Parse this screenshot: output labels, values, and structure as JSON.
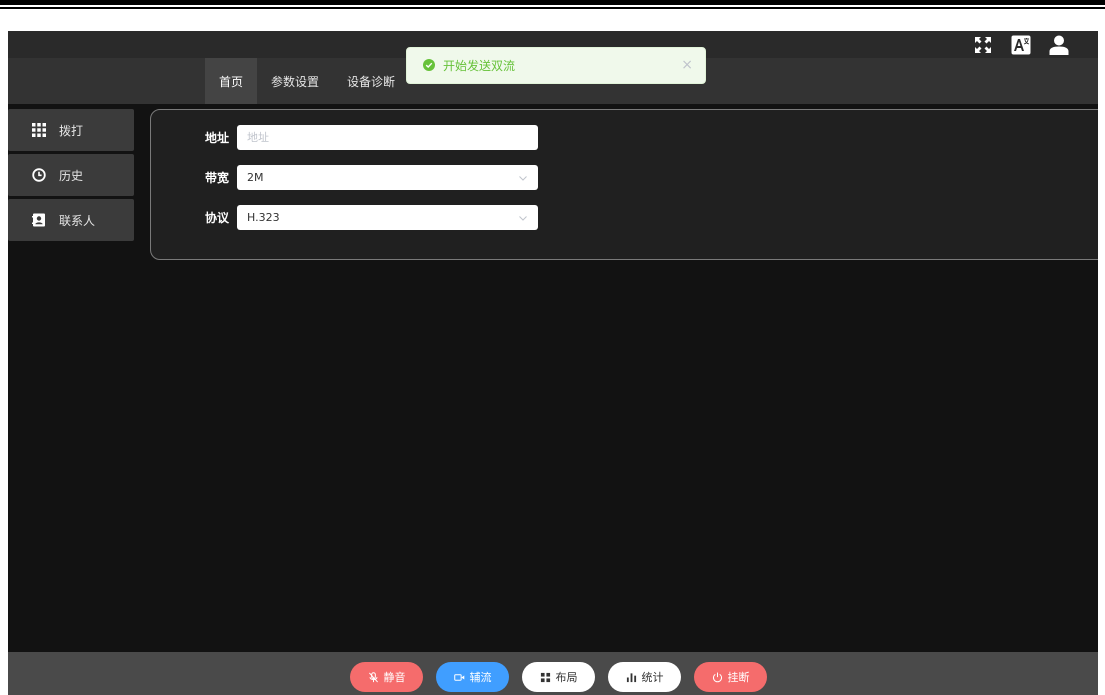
{
  "nav": {
    "tabs": [
      {
        "label": "首页",
        "active": true
      },
      {
        "label": "参数设置",
        "active": false
      },
      {
        "label": "设备诊断",
        "active": false
      }
    ]
  },
  "topbar": {
    "icons": [
      "fullscreen-icon",
      "translate-icon",
      "user-icon"
    ]
  },
  "toast": {
    "message": "开始发送双流",
    "close_glyph": "×",
    "type": "success",
    "color": "#67c23a"
  },
  "sidebar": {
    "items": [
      {
        "label": "拨打",
        "icon": "dialpad-icon"
      },
      {
        "label": "历史",
        "icon": "clock-icon"
      },
      {
        "label": "联系人",
        "icon": "contacts-icon"
      }
    ]
  },
  "form": {
    "address": {
      "label": "地址",
      "placeholder": "地址",
      "value": ""
    },
    "bandwidth": {
      "label": "带宽",
      "value": "2M"
    },
    "protocol": {
      "label": "协议",
      "value": "H.323"
    }
  },
  "controls": {
    "mute": {
      "label": "静音",
      "color": "#f56c6c"
    },
    "content": {
      "label": "辅流",
      "color": "#409eff"
    },
    "layout": {
      "label": "布局",
      "color": "#ffffff"
    },
    "stats": {
      "label": "统计",
      "color": "#ffffff"
    },
    "hangup": {
      "label": "挂断",
      "color": "#f56c6c"
    }
  }
}
